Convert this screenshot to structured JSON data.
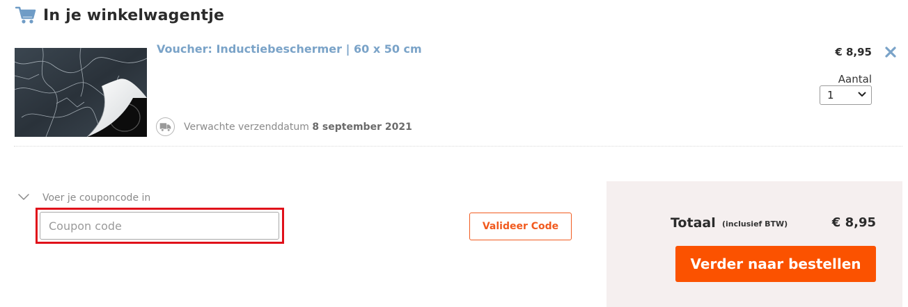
{
  "header": {
    "title": "In je winkelwagentje",
    "icon": "shopping-cart-icon"
  },
  "product": {
    "title": "Voucher: Inductiebeschermer | 60 x 50 cm",
    "image_icon": "marble-induction-protector-image",
    "price": "€ 8,95",
    "remove_icon": "close-icon",
    "quantity_label": "Aantal",
    "quantity_value": "1",
    "shipping": {
      "icon": "delivery-truck-icon",
      "label": "Verwachte verzenddatum",
      "date": "8 september 2021"
    }
  },
  "coupon": {
    "toggle_label": "Voer je couponcode in",
    "toggle_icon": "chevron-down-icon",
    "placeholder": "Coupon code",
    "value": "",
    "validate_label": "Valideer Code"
  },
  "totals": {
    "label": "Totaal",
    "note": "(inclusief BTW)",
    "amount": "€ 8,95",
    "order_button_label": "Verder naar bestellen"
  },
  "colors": {
    "link_blue": "#7aa3c8",
    "accent_orange": "#fb5200",
    "highlight_red": "#e0101a",
    "panel_bg": "#f5efef"
  }
}
